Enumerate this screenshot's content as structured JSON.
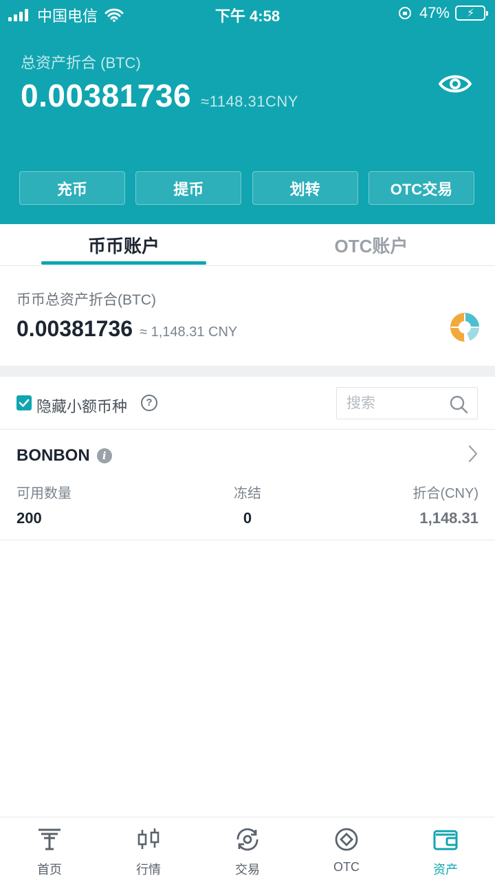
{
  "status_bar": {
    "carrier": "中国电信",
    "time": "下午 4:58",
    "battery": "47%",
    "battery_level": 0.47
  },
  "header": {
    "total_label": "总资产折合 (BTC)",
    "total_value": "0.00381736",
    "total_approx": "≈1148.31CNY",
    "actions": [
      "充币",
      "提币",
      "划转",
      "OTC交易"
    ]
  },
  "tabs": {
    "active": "币币账户",
    "inactive": "OTC账户"
  },
  "summary": {
    "label": "币币总资产折合(BTC)",
    "value": "0.00381736",
    "approx": "≈ 1,148.31 CNY"
  },
  "filter": {
    "hide_small_label": "隐藏小额币种",
    "hide_small_checked": true,
    "help_symbol": "?",
    "search_placeholder": "搜索"
  },
  "coins": [
    {
      "name": "BONBON",
      "available_label": "可用数量",
      "frozen_label": "冻结",
      "value_label": "折合(CNY)",
      "available": "200",
      "frozen": "0",
      "value": "1,148.31"
    }
  ],
  "tabbar": {
    "items": [
      "首页",
      "行情",
      "交易",
      "OTC",
      "资产"
    ],
    "active_index": 4
  },
  "colors": {
    "accent": "#10a5b1",
    "donut_orange": "#f2a93b",
    "donut_cyan": "#4dbfd0"
  },
  "icons": {
    "eye": "eye-icon",
    "search": "search-icon",
    "chevron": "chevron-right-icon",
    "info": "info-icon",
    "help": "help-icon",
    "home": "home-icon",
    "market": "candlestick-icon",
    "trade": "exchange-icon",
    "otc": "otc-diamond-icon",
    "assets": "wallet-icon"
  }
}
